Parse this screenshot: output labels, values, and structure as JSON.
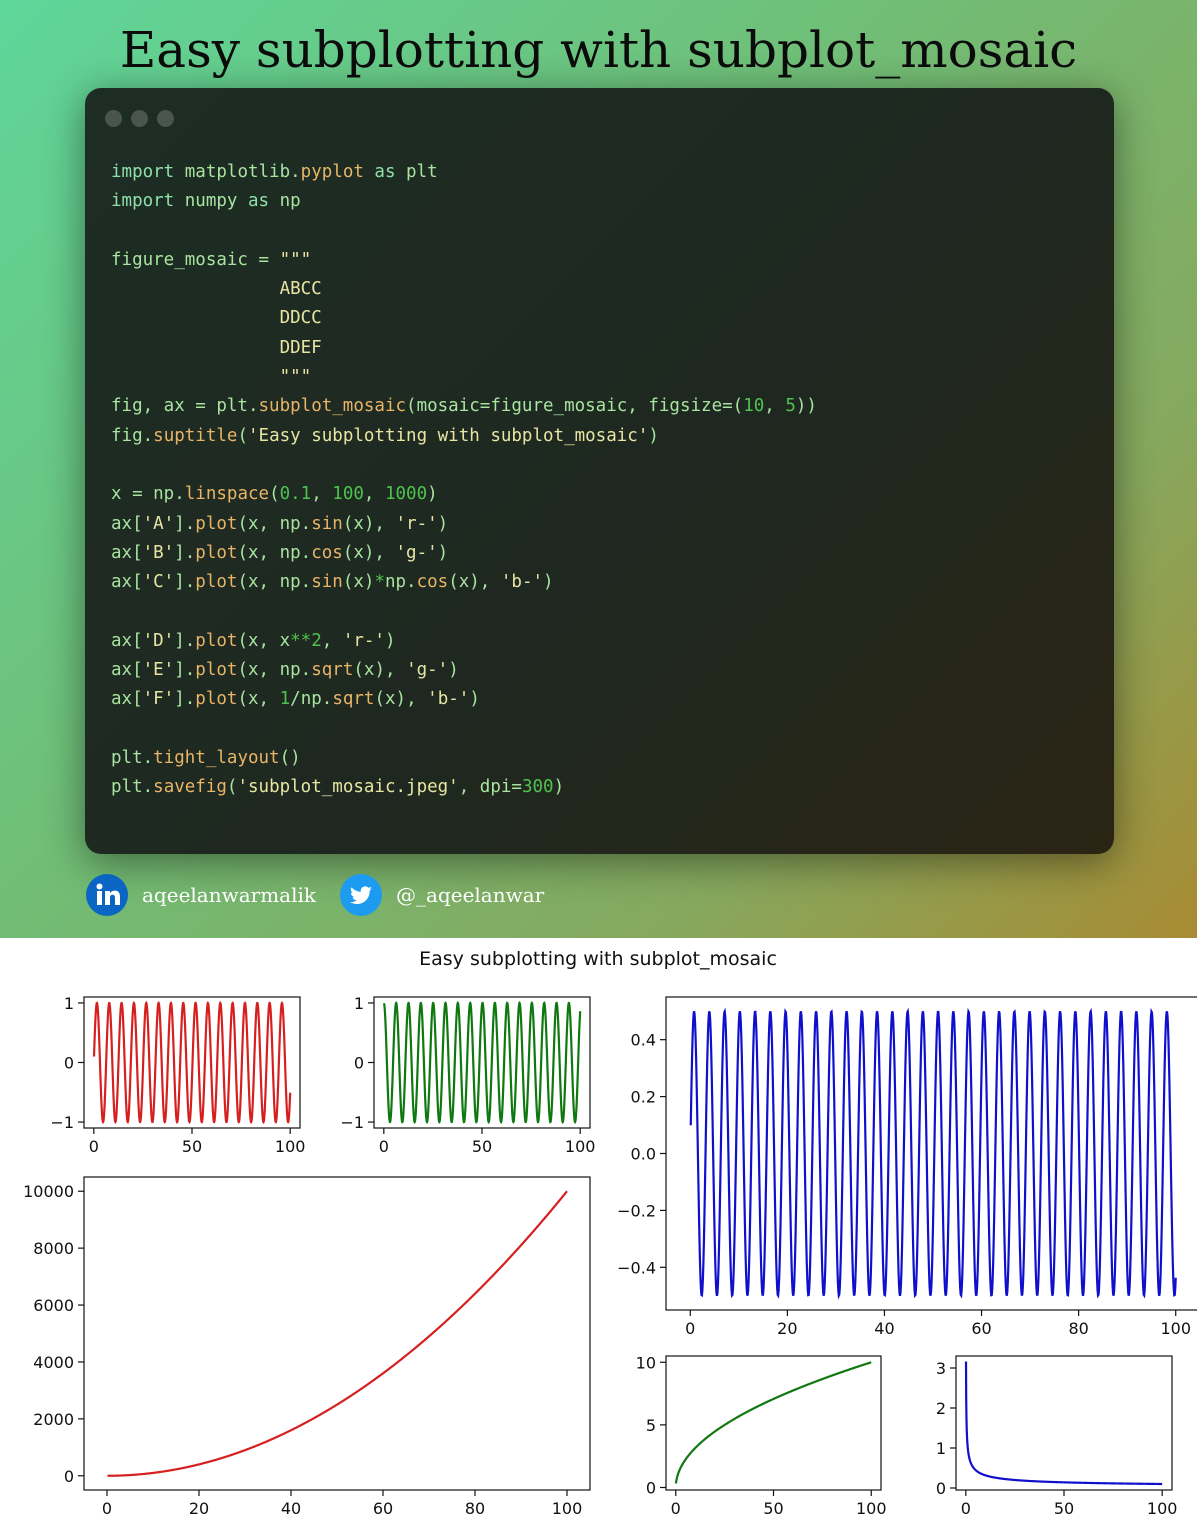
{
  "poster": {
    "title": "Easy subplotting with subplot_mosaic",
    "code_lines": [
      [
        [
          "kw",
          "import "
        ],
        [
          "pl",
          "matplotlib."
        ],
        [
          "fn",
          "pyplot"
        ],
        [
          "kw",
          " as "
        ],
        [
          "pl",
          "plt"
        ]
      ],
      [
        [
          "kw",
          "import "
        ],
        [
          "pl",
          "numpy"
        ],
        [
          "kw",
          " as "
        ],
        [
          "pl",
          "np"
        ]
      ],
      [],
      [
        [
          "pl",
          "figure_mosaic = "
        ],
        [
          "str",
          "\"\"\""
        ]
      ],
      [
        [
          "str",
          "                ABCC"
        ]
      ],
      [
        [
          "str",
          "                DDCC"
        ]
      ],
      [
        [
          "str",
          "                DDEF"
        ]
      ],
      [
        [
          "str",
          "                \"\"\""
        ]
      ],
      [
        [
          "pl",
          "fig, ax = plt."
        ],
        [
          "fn",
          "subplot_mosaic"
        ],
        [
          "pl",
          "(mosaic=figure_mosaic, figsize=("
        ],
        [
          "num",
          "10"
        ],
        [
          "pl",
          ", "
        ],
        [
          "num",
          "5"
        ],
        [
          "pl",
          "))"
        ]
      ],
      [
        [
          "pl",
          "fig."
        ],
        [
          "fn",
          "suptitle"
        ],
        [
          "pl",
          "("
        ],
        [
          "str",
          "'Easy subplotting with subplot_mosaic'"
        ],
        [
          "pl",
          ")"
        ]
      ],
      [],
      [
        [
          "pl",
          "x = np."
        ],
        [
          "fn",
          "linspace"
        ],
        [
          "pl",
          "("
        ],
        [
          "num",
          "0.1"
        ],
        [
          "pl",
          ", "
        ],
        [
          "num",
          "100"
        ],
        [
          "pl",
          ", "
        ],
        [
          "num",
          "1000"
        ],
        [
          "pl",
          ")"
        ]
      ],
      [
        [
          "pl",
          "ax["
        ],
        [
          "str",
          "'A'"
        ],
        [
          "pl",
          "]."
        ],
        [
          "fn",
          "plot"
        ],
        [
          "pl",
          "(x, np."
        ],
        [
          "fn",
          "sin"
        ],
        [
          "pl",
          "(x), "
        ],
        [
          "str",
          "'r-'"
        ],
        [
          "pl",
          ")"
        ]
      ],
      [
        [
          "pl",
          "ax["
        ],
        [
          "str",
          "'B'"
        ],
        [
          "pl",
          "]."
        ],
        [
          "fn",
          "plot"
        ],
        [
          "pl",
          "(x, np."
        ],
        [
          "fn",
          "cos"
        ],
        [
          "pl",
          "(x), "
        ],
        [
          "str",
          "'g-'"
        ],
        [
          "pl",
          ")"
        ]
      ],
      [
        [
          "pl",
          "ax["
        ],
        [
          "str",
          "'C'"
        ],
        [
          "pl",
          "]."
        ],
        [
          "fn",
          "plot"
        ],
        [
          "pl",
          "(x, np."
        ],
        [
          "fn",
          "sin"
        ],
        [
          "pl",
          "(x)"
        ],
        [
          "num",
          "*"
        ],
        [
          "pl",
          "np."
        ],
        [
          "fn",
          "cos"
        ],
        [
          "pl",
          "(x), "
        ],
        [
          "str",
          "'b-'"
        ],
        [
          "pl",
          ")"
        ]
      ],
      [],
      [
        [
          "pl",
          "ax["
        ],
        [
          "str",
          "'D'"
        ],
        [
          "pl",
          "]."
        ],
        [
          "fn",
          "plot"
        ],
        [
          "pl",
          "(x, x"
        ],
        [
          "num",
          "**2"
        ],
        [
          "pl",
          ", "
        ],
        [
          "str",
          "'r-'"
        ],
        [
          "pl",
          ")"
        ]
      ],
      [
        [
          "pl",
          "ax["
        ],
        [
          "str",
          "'E'"
        ],
        [
          "pl",
          "]."
        ],
        [
          "fn",
          "plot"
        ],
        [
          "pl",
          "(x, np."
        ],
        [
          "fn",
          "sqrt"
        ],
        [
          "pl",
          "(x), "
        ],
        [
          "str",
          "'g-'"
        ],
        [
          "pl",
          ")"
        ]
      ],
      [
        [
          "pl",
          "ax["
        ],
        [
          "str",
          "'F'"
        ],
        [
          "pl",
          "]."
        ],
        [
          "fn",
          "plot"
        ],
        [
          "pl",
          "(x, "
        ],
        [
          "num",
          "1"
        ],
        [
          "pl",
          "/np."
        ],
        [
          "fn",
          "sqrt"
        ],
        [
          "pl",
          "(x), "
        ],
        [
          "str",
          "'b-'"
        ],
        [
          "pl",
          ")"
        ]
      ],
      [],
      [
        [
          "pl",
          "plt."
        ],
        [
          "fn",
          "tight_layout"
        ],
        [
          "pl",
          "()"
        ]
      ],
      [
        [
          "pl",
          "plt."
        ],
        [
          "fn",
          "savefig"
        ],
        [
          "pl",
          "("
        ],
        [
          "str",
          "'subplot_mosaic.jpeg'"
        ],
        [
          "pl",
          ", dpi="
        ],
        [
          "num",
          "300"
        ],
        [
          "pl",
          ")"
        ]
      ]
    ],
    "social": {
      "linkedin": {
        "icon": "linkedin-icon",
        "handle": "aqeelanwarmalik",
        "color": "#0a66c2"
      },
      "twitter": {
        "icon": "twitter-icon",
        "handle": "@_aqeelanwar",
        "color": "#1d9bf0"
      }
    }
  },
  "chart_data": {
    "suptitle": "Easy subplotting with subplot_mosaic",
    "layout": [
      "ABCC",
      "DDCC",
      "DDEF"
    ],
    "x_range": [
      0.1,
      100
    ],
    "axes": [
      {
        "id": "A",
        "type": "line",
        "function": "sin(x)",
        "color": "#d62020",
        "xlim": [
          -5,
          105
        ],
        "ylim": [
          -1.1,
          1.1
        ],
        "xticks": [
          0,
          50,
          100
        ],
        "yticks": [
          -1,
          0,
          1
        ],
        "xticklabels": [
          "0",
          "50",
          "100"
        ],
        "yticklabels": [
          "−1",
          "0",
          "1"
        ]
      },
      {
        "id": "B",
        "type": "line",
        "function": "cos(x)",
        "color": "#107810",
        "xlim": [
          -5,
          105
        ],
        "ylim": [
          -1.1,
          1.1
        ],
        "xticks": [
          0,
          50,
          100
        ],
        "yticks": [
          -1,
          0,
          1
        ],
        "xticklabels": [
          "0",
          "50",
          "100"
        ],
        "yticklabels": [
          "−1",
          "0",
          "1"
        ]
      },
      {
        "id": "C",
        "type": "line",
        "function": "sin(x)*cos(x)",
        "color": "#1010cc",
        "xlim": [
          -5,
          105
        ],
        "ylim": [
          -0.55,
          0.55
        ],
        "xticks": [
          0,
          20,
          40,
          60,
          80,
          100
        ],
        "yticks": [
          -0.4,
          -0.2,
          0,
          0.2,
          0.4
        ],
        "xticklabels": [
          "0",
          "20",
          "40",
          "60",
          "80",
          "100"
        ],
        "yticklabels": [
          "−0.4",
          "−0.2",
          "0.0",
          "0.2",
          "0.4"
        ]
      },
      {
        "id": "D",
        "type": "line",
        "function": "x**2",
        "color": "#d62020",
        "xlim": [
          -5,
          105
        ],
        "ylim": [
          -500,
          10500
        ],
        "xticks": [
          0,
          20,
          40,
          60,
          80,
          100
        ],
        "yticks": [
          0,
          2000,
          4000,
          6000,
          8000,
          10000
        ],
        "xticklabels": [
          "0",
          "20",
          "40",
          "60",
          "80",
          "100"
        ],
        "yticklabels": [
          "0",
          "2000",
          "4000",
          "6000",
          "8000",
          "10000"
        ]
      },
      {
        "id": "E",
        "type": "line",
        "function": "sqrt(x)",
        "color": "#107810",
        "xlim": [
          -5,
          105
        ],
        "ylim": [
          -0.2,
          10.5
        ],
        "xticks": [
          0,
          50,
          100
        ],
        "yticks": [
          0,
          5,
          10
        ],
        "xticklabels": [
          "0",
          "50",
          "100"
        ],
        "yticklabels": [
          "0",
          "5",
          "10"
        ]
      },
      {
        "id": "F",
        "type": "line",
        "function": "1/sqrt(x)",
        "color": "#1010cc",
        "xlim": [
          -5,
          105
        ],
        "ylim": [
          -0.05,
          3.3
        ],
        "xticks": [
          0,
          50,
          100
        ],
        "yticks": [
          0,
          1,
          2,
          3
        ],
        "xticklabels": [
          "0",
          "50",
          "100"
        ],
        "yticklabels": [
          "0",
          "1",
          "2",
          "3"
        ]
      }
    ]
  }
}
